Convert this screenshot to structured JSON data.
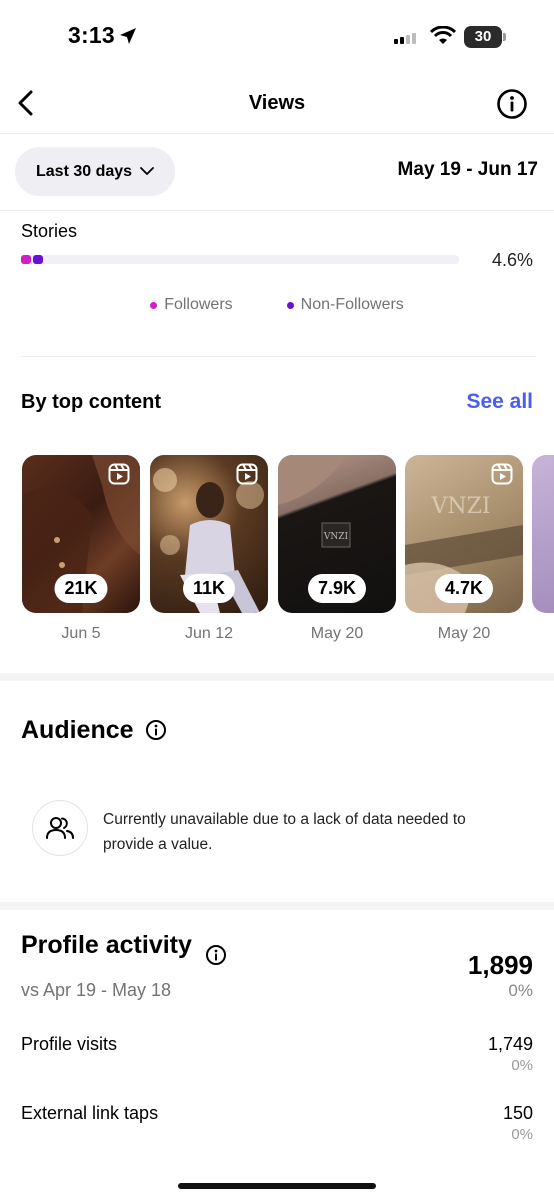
{
  "status_bar": {
    "time": "3:13",
    "battery": "30"
  },
  "nav": {
    "title": "Views",
    "back_icon": "chevron-left-icon",
    "info_icon": "info-icon"
  },
  "filter": {
    "range_label": "Last 30 days",
    "date_range": "May 19 - Jun 17"
  },
  "stories": {
    "label": "Stories",
    "percent": "4.6%",
    "followers_share_pct": 2.2,
    "non_followers_share_pct": 2.4,
    "colors": {
      "followers": "#d31bc9",
      "non_followers": "#6a0fd8"
    }
  },
  "legend": {
    "followers": "Followers",
    "non_followers": "Non-Followers"
  },
  "top_content": {
    "title": "By top content",
    "see_all": "See all",
    "items": [
      {
        "views": "21K",
        "date": "Jun 5",
        "type_icon": "reel-icon"
      },
      {
        "views": "11K",
        "date": "Jun 12",
        "type_icon": "reel-icon"
      },
      {
        "views": "7.9K",
        "date": "May 20",
        "type_icon": "none"
      },
      {
        "views": "4.7K",
        "date": "May 20",
        "type_icon": "reel-icon"
      }
    ],
    "accent_color": "#4a5df0"
  },
  "audience": {
    "title": "Audience",
    "message": "Currently unavailable due to a lack of data needed to provide a value.",
    "icon": "people-icon"
  },
  "profile_activity": {
    "title": "Profile activity",
    "comparison": "vs Apr 19 - May 18",
    "total": "1,899",
    "total_change": "0%",
    "rows": [
      {
        "label": "Profile visits",
        "value": "1,749",
        "change": "0%"
      },
      {
        "label": "External link taps",
        "value": "150",
        "change": "0%"
      }
    ]
  }
}
